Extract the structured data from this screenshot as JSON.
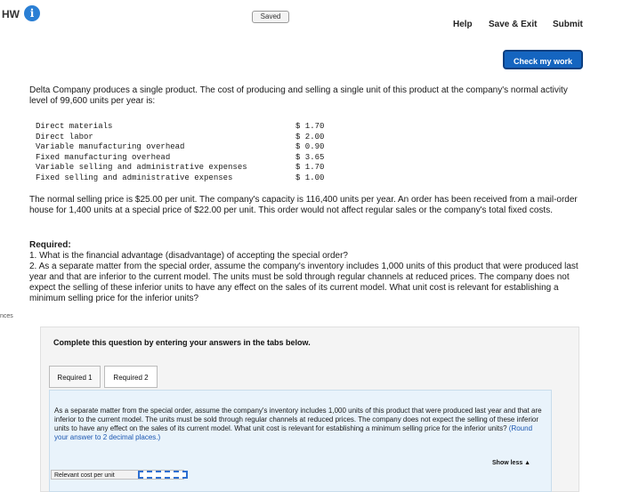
{
  "header": {
    "app_label": "HW",
    "info_icon": "i",
    "saved_label": "Saved",
    "help_label": "Help",
    "save_exit_label": "Save & Exit",
    "submit_label": "Submit",
    "check_work_label": "Check my work"
  },
  "sidebar": {
    "label": "nces"
  },
  "problem": {
    "intro": "Delta Company produces a single product. The cost of producing and selling a single unit of this product at the company's normal activity level of 99,600 units per year is:",
    "costs": [
      {
        "label": "Direct materials",
        "value": "$ 1.70"
      },
      {
        "label": "Direct labor",
        "value": "$ 2.00"
      },
      {
        "label": "Variable manufacturing overhead",
        "value": "$ 0.90"
      },
      {
        "label": "Fixed manufacturing overhead",
        "value": "$ 3.65"
      },
      {
        "label": "Variable selling and administrative expenses",
        "value": "$ 1.70"
      },
      {
        "label": "Fixed selling and administrative expenses",
        "value": "$ 1.00"
      }
    ],
    "normal_price": "The normal selling price is $25.00 per unit. The company's capacity is 116,400 units per year. An order has been received from a mail-order house for 1,400 units at a special price of $22.00 per unit. This order would not affect regular sales or the company's total fixed costs.",
    "required_heading": "Required:",
    "required_1": "1. What is the financial advantage (disadvantage) of accepting the special order?",
    "required_2": "2. As a separate matter from the special order, assume the company's inventory includes 1,000 units of this product that were produced last year and that are inferior to the current model. The units must be sold through regular channels at reduced prices. The company does not expect the selling of these inferior units to have any effect on the sales of its current model. What unit cost is relevant for establishing a minimum selling price for the inferior units?"
  },
  "answer_panel": {
    "instruction": "Complete this question by entering your answers in the tabs below.",
    "tabs": [
      {
        "label": "Required 1"
      },
      {
        "label": "Required 2"
      }
    ],
    "question": "As a separate matter from the special order, assume the company's inventory includes 1,000 units of this product that were produced last year and that are inferior to the current model. The units must be sold through regular channels at reduced prices. The company does not expect the selling of these inferior units to have any effect on the sales of its current model. What unit cost is relevant for establishing a minimum selling price for the inferior units?",
    "question_hint": "(Round your answer to 2 decimal places.)",
    "show_less_label": "Show less ▲",
    "answer_row_label": "Relevant cost per unit",
    "answer_value": ""
  }
}
